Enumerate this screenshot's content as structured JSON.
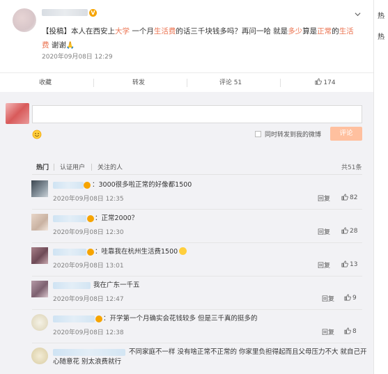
{
  "post": {
    "prefix": "【投稿】",
    "text_parts": [
      {
        "t": "本人在西安上",
        "hl": false
      },
      {
        "t": "大学",
        "hl": true
      },
      {
        "t": " 一个月",
        "hl": false
      },
      {
        "t": "生活费",
        "hl": true
      },
      {
        "t": "的话三千块钱多吗？再问一哈 就是",
        "hl": false
      },
      {
        "t": "多少",
        "hl": true
      },
      {
        "t": "算是",
        "hl": false
      },
      {
        "t": "正常",
        "hl": true
      },
      {
        "t": "的",
        "hl": false
      },
      {
        "t": "生活费",
        "hl": true
      },
      {
        "t": " 谢谢",
        "hl": false
      }
    ],
    "time": "2020年09月08日 12:29"
  },
  "actions": {
    "favorite": "收藏",
    "repost": "转发",
    "comment": "评论 51",
    "like": "174"
  },
  "composer": {
    "sync_label": "同时转发到我的微博",
    "submit_label": "评论"
  },
  "tabs": {
    "hot": "热门",
    "verified": "认证用户",
    "following": "关注的人",
    "total": "共51条"
  },
  "comments": [
    {
      "text": "：3000很多啦正常的好像都1500",
      "time": "2020年09月08日 12:35",
      "reply": "回复",
      "likes": "82"
    },
    {
      "text": "：正常2000？",
      "time": "2020年09月08日 12:30",
      "reply": "回复",
      "likes": "28"
    },
    {
      "text": "：哇靠我在杭州生活费1500",
      "time": "2020年09月08日 13:01",
      "reply": "回复",
      "likes": "13"
    },
    {
      "text": "我在广东一千五",
      "time": "2020年09月08日 12:47",
      "reply": "回复",
      "likes": "9"
    },
    {
      "text": "：开学第一个月确实会花钱较多 但是三千真的挺多的",
      "time": "2020年09月08日 12:38",
      "reply": "回复",
      "likes": "8"
    },
    {
      "text": "不同家庭不一样 没有啥正常不正常的 你家里负担得起而且父母压力不大 就自己开",
      "text2": "心随意花 别太浪费就行"
    }
  ],
  "right_strip": {
    "t1": "热",
    "t2": "热"
  },
  "colors": {
    "highlight": "#eb7350",
    "badge": "#f6a400",
    "submit_disabled": "#ffc09f"
  }
}
